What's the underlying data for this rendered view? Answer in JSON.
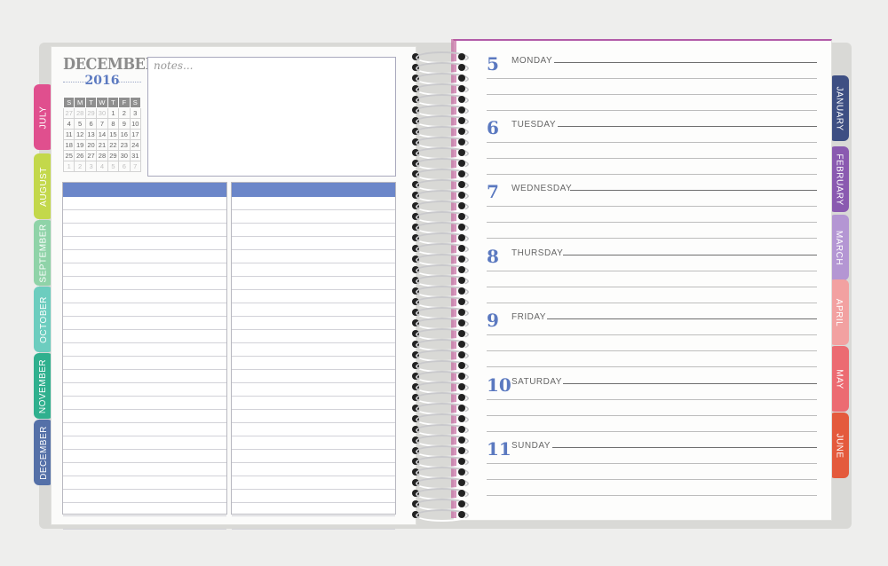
{
  "left_tabs": [
    {
      "label": "JULY",
      "color": "#e04f8e"
    },
    {
      "label": "AUGUST",
      "color": "#c3d84b"
    },
    {
      "label": "SEPTEMBER",
      "color": "#8fd3a8"
    },
    {
      "label": "OCTOBER",
      "color": "#6ccdbf"
    },
    {
      "label": "NOVEMBER",
      "color": "#2fb08e"
    },
    {
      "label": "DECEMBER",
      "color": "#5470a8"
    }
  ],
  "right_tabs": [
    {
      "label": "JANUARY",
      "color": "#3e4f83"
    },
    {
      "label": "FEBRUARY",
      "color": "#8a5ab0"
    },
    {
      "label": "MARCH",
      "color": "#b496d3"
    },
    {
      "label": "APRIL",
      "color": "#f2a1a1"
    },
    {
      "label": "MAY",
      "color": "#ec6b72"
    },
    {
      "label": "JUNE",
      "color": "#e45a3c"
    }
  ],
  "calendar": {
    "month": "DECEMBER",
    "year": "2016",
    "weekdays": [
      "S",
      "M",
      "T",
      "W",
      "T",
      "F",
      "S"
    ],
    "weeks": [
      [
        {
          "d": "27",
          "m": true
        },
        {
          "d": "28",
          "m": true
        },
        {
          "d": "29",
          "m": true
        },
        {
          "d": "30",
          "m": true
        },
        {
          "d": "1"
        },
        {
          "d": "2"
        },
        {
          "d": "3"
        }
      ],
      [
        {
          "d": "4"
        },
        {
          "d": "5"
        },
        {
          "d": "6"
        },
        {
          "d": "7"
        },
        {
          "d": "8"
        },
        {
          "d": "9"
        },
        {
          "d": "10"
        }
      ],
      [
        {
          "d": "11"
        },
        {
          "d": "12"
        },
        {
          "d": "13"
        },
        {
          "d": "14"
        },
        {
          "d": "15"
        },
        {
          "d": "16"
        },
        {
          "d": "17"
        }
      ],
      [
        {
          "d": "18"
        },
        {
          "d": "19"
        },
        {
          "d": "20"
        },
        {
          "d": "21"
        },
        {
          "d": "22"
        },
        {
          "d": "23"
        },
        {
          "d": "24"
        }
      ],
      [
        {
          "d": "25"
        },
        {
          "d": "26"
        },
        {
          "d": "27"
        },
        {
          "d": "28"
        },
        {
          "d": "29"
        },
        {
          "d": "30"
        },
        {
          "d": "31"
        }
      ],
      [
        {
          "d": "1",
          "m": true
        },
        {
          "d": "2",
          "m": true
        },
        {
          "d": "3",
          "m": true
        },
        {
          "d": "4",
          "m": true
        },
        {
          "d": "5",
          "m": true
        },
        {
          "d": "6",
          "m": true
        },
        {
          "d": "7",
          "m": true
        }
      ]
    ]
  },
  "notes": {
    "label": "notes..."
  },
  "days": [
    {
      "num": "5",
      "name": "MONDAY"
    },
    {
      "num": "6",
      "name": "TUESDAY"
    },
    {
      "num": "7",
      "name": "WEDNESDAY"
    },
    {
      "num": "8",
      "name": "THURSDAY"
    },
    {
      "num": "9",
      "name": "FRIDAY"
    },
    {
      "num": "10",
      "name": "SATURDAY"
    },
    {
      "num": "11",
      "name": "SUNDAY"
    }
  ],
  "colors": {
    "accent_blue": "#5b79c0",
    "list_header": "#6b86c9"
  }
}
